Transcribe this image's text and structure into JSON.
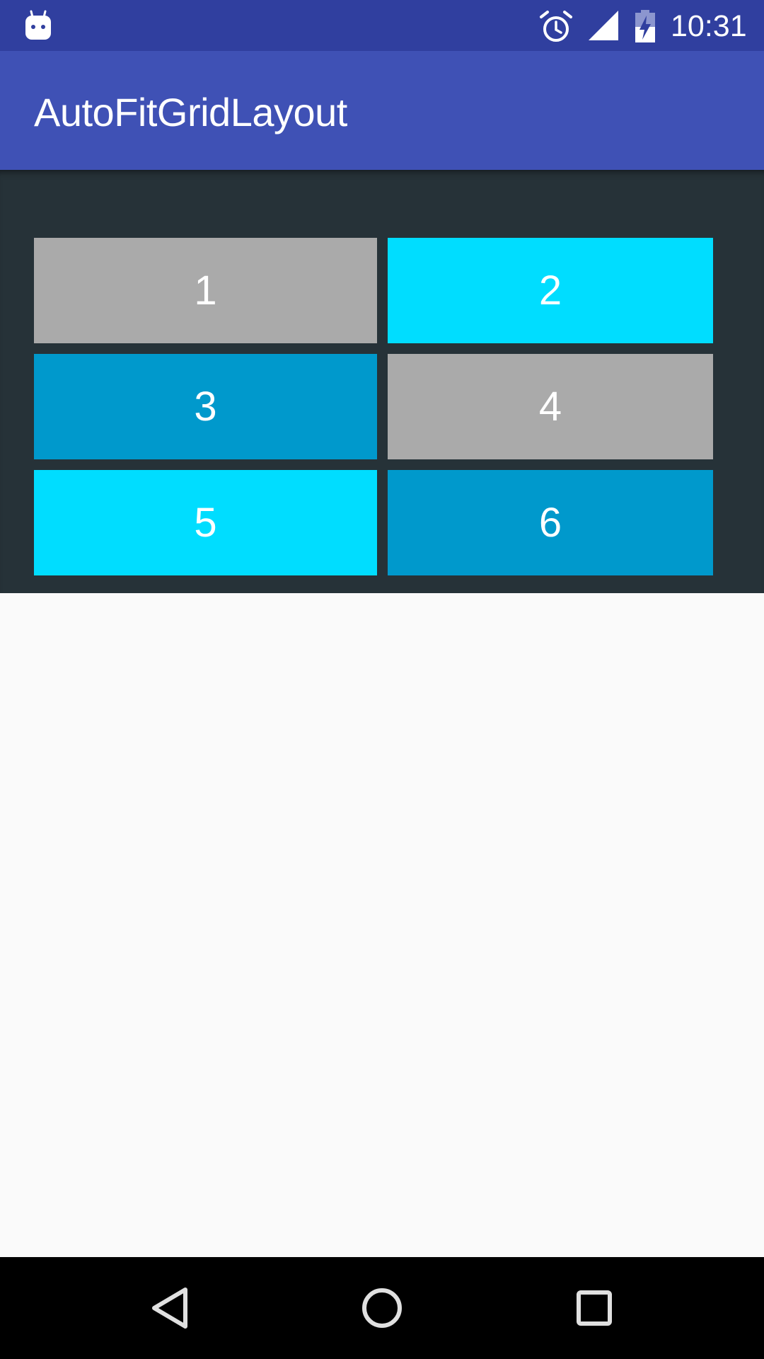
{
  "status_bar": {
    "time": "10:31",
    "icons": [
      "android-notification-icon",
      "alarm-icon",
      "cell-signal-icon",
      "battery-charging-icon"
    ]
  },
  "app_bar": {
    "title": "AutoFitGridLayout"
  },
  "grid": {
    "tiles": [
      {
        "label": "1",
        "color": "#aaaaaa"
      },
      {
        "label": "2",
        "color": "#00ddff"
      },
      {
        "label": "3",
        "color": "#0099cc"
      },
      {
        "label": "4",
        "color": "#aaaaaa"
      },
      {
        "label": "5",
        "color": "#00ddff"
      },
      {
        "label": "6",
        "color": "#0099cc"
      }
    ]
  },
  "nav_bar": {
    "buttons": [
      "back-icon",
      "home-icon",
      "recents-icon"
    ]
  },
  "colors": {
    "status_bar": "#303f9f",
    "app_bar": "#3f51b5",
    "grid_background": "#263238",
    "content_background": "#fafafa",
    "nav_bar": "#000000"
  }
}
